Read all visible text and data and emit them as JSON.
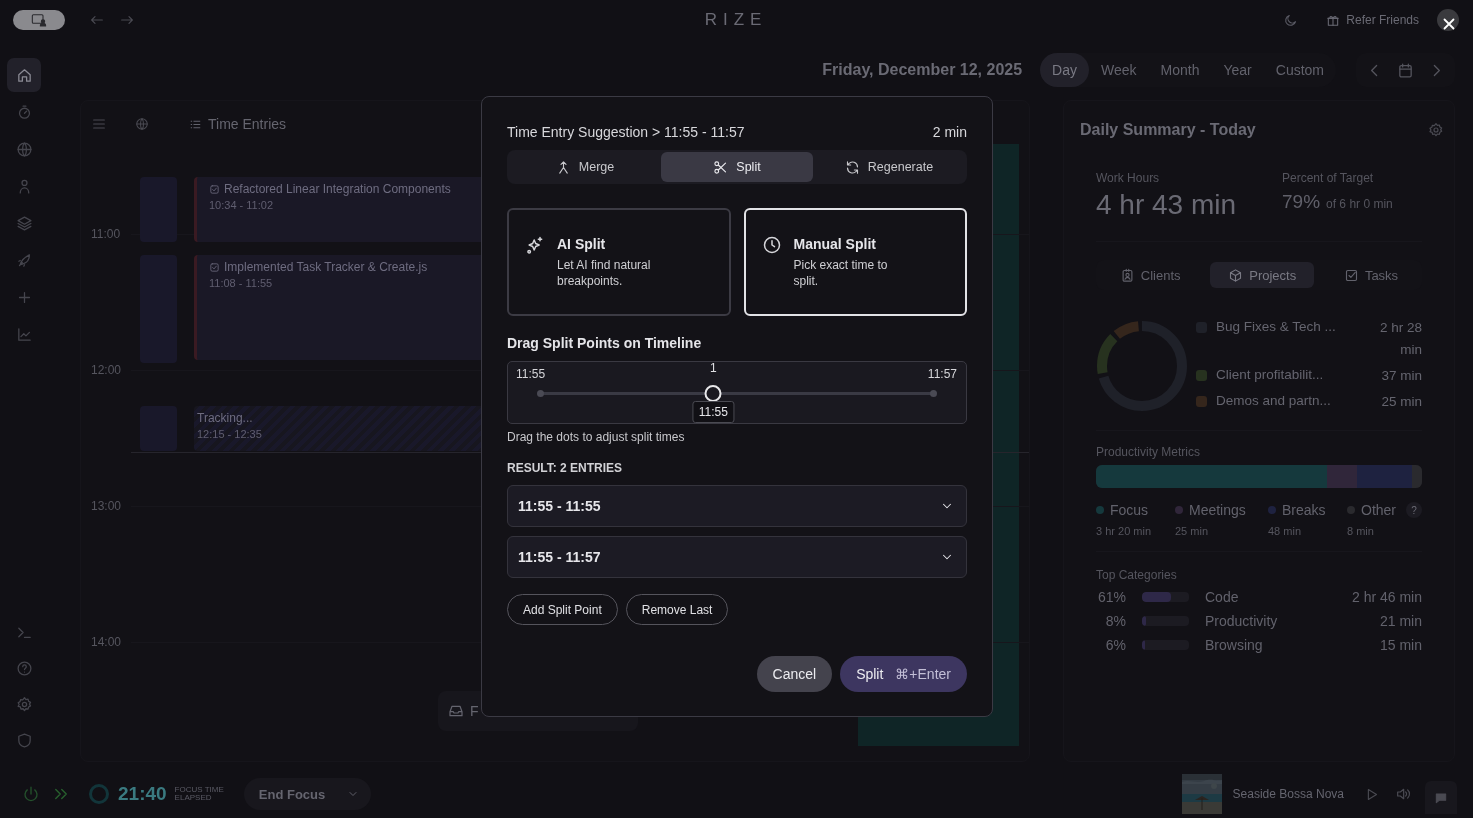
{
  "top_bar": {
    "app_title": "RIZE",
    "refer_button": "Refer Friends"
  },
  "sidebar": {
    "items": [
      {
        "kind": "home",
        "selected": true
      },
      {
        "kind": "timer",
        "selected": false
      },
      {
        "kind": "globe",
        "selected": false
      },
      {
        "kind": "user",
        "selected": false
      },
      {
        "kind": "layers",
        "selected": false
      },
      {
        "kind": "rocket",
        "selected": false
      },
      {
        "kind": "plus",
        "selected": false
      },
      {
        "kind": "chart",
        "selected": false
      }
    ],
    "bottom_items": [
      {
        "kind": "terminal",
        "selected": false
      },
      {
        "kind": "help",
        "selected": false
      },
      {
        "kind": "gear",
        "selected": false
      },
      {
        "kind": "shield",
        "selected": false
      }
    ]
  },
  "header": {
    "date": "Friday, December 12, 2025",
    "ranges": [
      {
        "label": "Day",
        "selected": true
      },
      {
        "label": "Week",
        "selected": false
      },
      {
        "label": "Month",
        "selected": false
      },
      {
        "label": "Year",
        "selected": false
      },
      {
        "label": "Custom",
        "selected": false
      }
    ]
  },
  "timeline": {
    "title": "Time Entries",
    "hours": [
      "11:00",
      "12:00",
      "13:00",
      "14:00"
    ],
    "entries": [
      {
        "kind": "task",
        "title": "Refactored Linear Integration Components",
        "time": "10:34 - 11:02"
      },
      {
        "kind": "task",
        "title": "Implemented Task Tracker & Create.js",
        "time": "11:08 - 11:55"
      },
      {
        "kind": "tracking",
        "title": "Tracking...",
        "time": "12:15 - 12:35"
      }
    ],
    "floating_button": "F"
  },
  "summary": {
    "title": "Daily Summary - Today",
    "work_hours": {
      "label": "Work Hours",
      "value": "4 hr 43 min"
    },
    "target": {
      "label": "Percent of Target",
      "value": "79%",
      "detail": "of 6 hr 0 min"
    },
    "tabs": [
      {
        "kind": "clients",
        "label": "Clients",
        "selected": false
      },
      {
        "kind": "projects",
        "label": "Projects",
        "selected": true
      },
      {
        "kind": "tasks",
        "label": "Tasks",
        "selected": false
      }
    ],
    "projects": [
      {
        "name": "Bug Fixes & Tech ...",
        "time": "2 hr 28 min",
        "color": "#1f2129"
      },
      {
        "name": "Client profitabilit...",
        "time": "37 min",
        "color": "#27321f"
      },
      {
        "name": "Demos and partn...",
        "time": "25 min",
        "color": "#35261c"
      }
    ],
    "metrics": {
      "title": "Productivity Metrics",
      "help": "?",
      "items": [
        {
          "name": "Focus",
          "time": "3 hr 20 min",
          "color": "#15393d"
        },
        {
          "name": "Meetings",
          "time": "25 min",
          "color": "#30263a"
        },
        {
          "name": "Breaks",
          "time": "48 min",
          "color": "#1e2240"
        },
        {
          "name": "Other",
          "time": "8 min",
          "color": "#2a2a2e"
        }
      ]
    },
    "categories": {
      "title": "Top Categories",
      "items": [
        {
          "percent": "61%",
          "name": "Code",
          "time": "2 hr 46 min",
          "level": 0.61
        },
        {
          "percent": "8%",
          "name": "Productivity",
          "time": "21 min",
          "level": 0.08
        },
        {
          "percent": "6%",
          "name": "Browsing",
          "time": "15 min",
          "level": 0.06
        }
      ]
    }
  },
  "bottom_bar": {
    "timer": "21:40",
    "timer_caption": [
      "FOCUS TIME",
      "ELAPSED"
    ],
    "end_button": "End Focus",
    "track": "Seaside Bossa Nova"
  },
  "dialog": {
    "title": "Time Entry Suggestion > 11:55 - 11:57",
    "duration": "2 min",
    "tabs": [
      {
        "kind": "merge",
        "label": "Merge",
        "selected": false
      },
      {
        "kind": "split",
        "label": "Split",
        "selected": true
      },
      {
        "kind": "regenerate",
        "label": "Regenerate",
        "selected": false
      }
    ],
    "modes": [
      {
        "kind": "ai",
        "title": "AI Split",
        "description": "Let AI find natural breakpoints.",
        "selected": false
      },
      {
        "kind": "manual",
        "title": "Manual Split",
        "description": "Pick exact time to split.",
        "selected": true
      }
    ],
    "timeline_heading": "Drag Split Points on Timeline",
    "timeline": {
      "start": "11:55",
      "end": "11:57",
      "points": [
        {
          "label": "1",
          "time": "11:55",
          "level": 0.44
        }
      ]
    },
    "hint": "Drag the dots to adjust split times",
    "result_heading": "RESULT: 2 ENTRIES",
    "entries": [
      "11:55 - 11:55",
      "11:55 - 11:57"
    ],
    "actions": [
      "Add Split Point",
      "Remove Last"
    ],
    "cancel": "Cancel",
    "confirm": "Split",
    "shortcut": "⌘+Enter"
  }
}
